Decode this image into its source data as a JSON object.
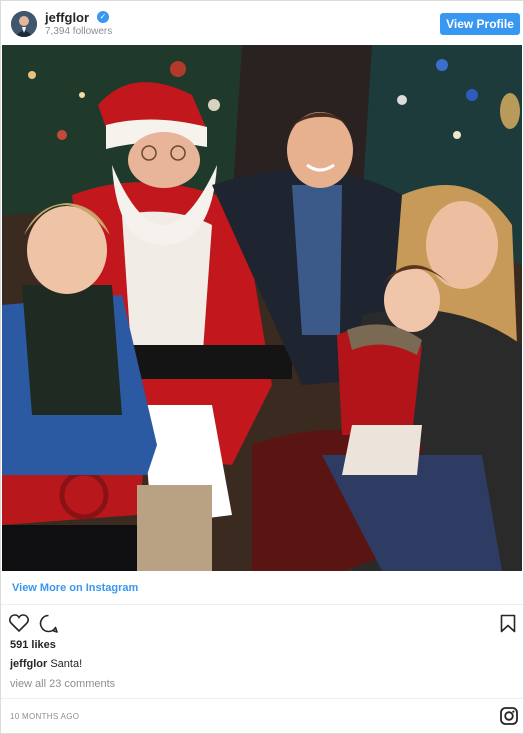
{
  "header": {
    "username": "jeffglor",
    "followers": "7,394 followers",
    "view_profile_label": "View Profile"
  },
  "photo": {
    "description_icon": "family-christmas-photo"
  },
  "view_more": {
    "label": "View More on Instagram"
  },
  "post": {
    "likes": "591 likes",
    "caption_user": "jeffglor",
    "caption_text": "Santa!",
    "comments_link": "view all 23 comments",
    "timestamp": "10 MONTHS AGO"
  },
  "colors": {
    "accent": "#3897f0",
    "text": "#262626",
    "muted": "#8e8e8e"
  }
}
